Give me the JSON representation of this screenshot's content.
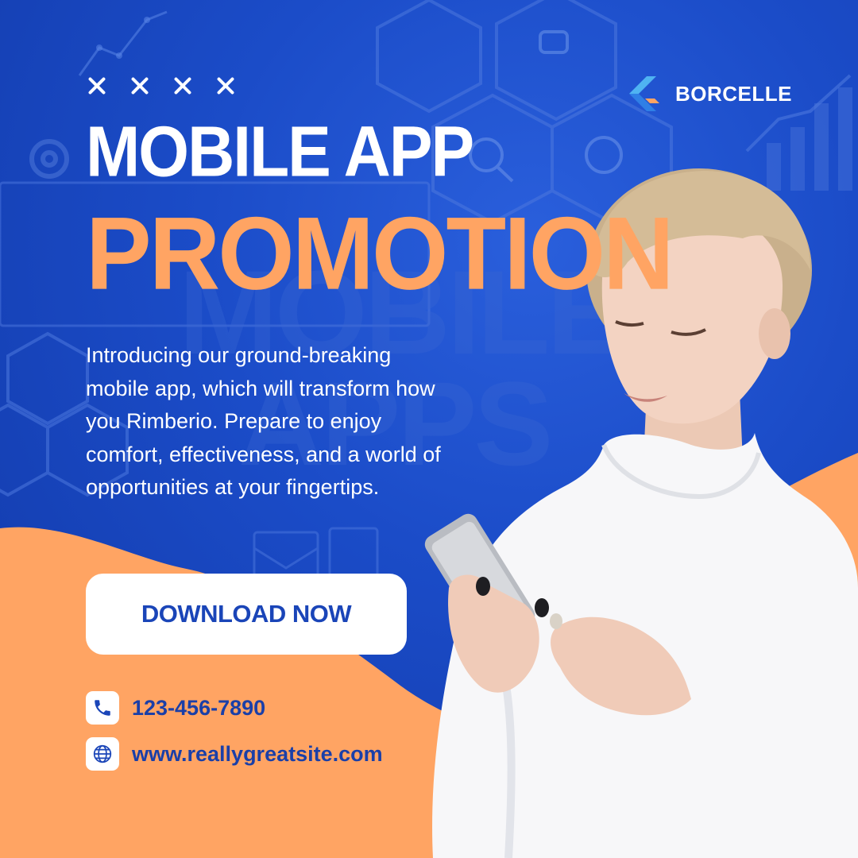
{
  "brand": {
    "name": "BORCELLE",
    "logo_icon": "chevron-logo-icon"
  },
  "decor": {
    "marks": [
      "x-mark",
      "x-mark",
      "x-mark",
      "x-mark"
    ]
  },
  "headline": {
    "line1": "MOBILE APP",
    "line2": "PROMOTION"
  },
  "background_words": {
    "line1": "MOBILE",
    "line2": "APPS"
  },
  "description": "Introducing our ground-breaking mobile app, which will transform how you Rimberio. Prepare to enjoy comfort, effectiveness, and a world of opportunities at your fingertips.",
  "cta": {
    "label": "DOWNLOAD NOW"
  },
  "contact": {
    "phone": "123-456-7890",
    "phone_icon": "phone-icon",
    "website": "www.reallygreatsite.com",
    "website_icon": "globe-icon"
  },
  "colors": {
    "primary_blue": "#1b4cc8",
    "accent_orange": "#ffa463",
    "white": "#ffffff",
    "text_blue": "#1a45b8"
  }
}
